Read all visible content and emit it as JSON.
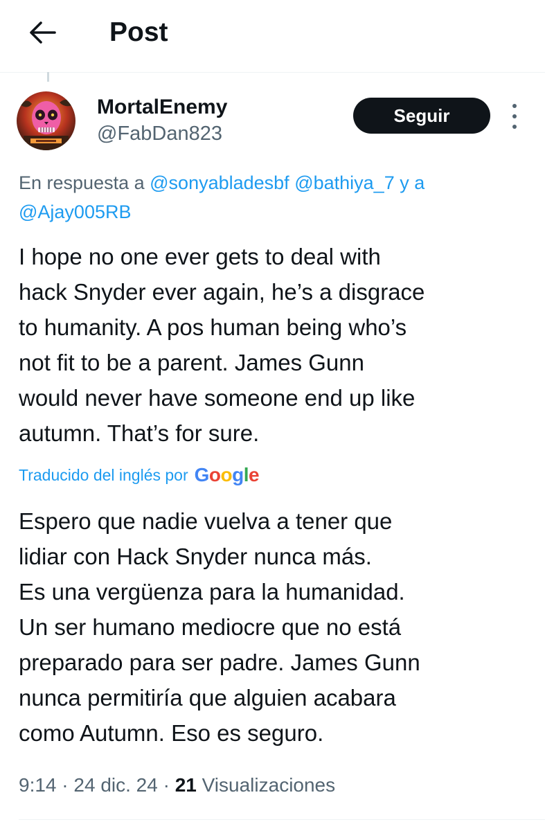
{
  "header": {
    "title": "Post",
    "back_icon": "arrow-left-icon"
  },
  "post": {
    "author": {
      "name": "MortalEnemy",
      "handle": "@FabDan823",
      "avatar": "avatar-image"
    },
    "follow_label": "Seguir",
    "more_icon": "more-vertical-icon",
    "reply_to": {
      "prefix": "En respuesta a",
      "mentions": [
        "@sonyabladesbf",
        "@bathiya_7"
      ],
      "joiner": "y a",
      "last_mention": "@Ajay005RB"
    },
    "text": "I hope no one ever gets to deal with\nhack Snyder ever again, he’s a disgrace\nto humanity. A pos human being who’s\nnot fit to be a parent. James Gunn\nwould never have someone end up like\nautumn. That’s for sure.",
    "translation_label": "Traducido del inglés por",
    "translation_provider": "Google",
    "translated_text": "Espero que nadie vuelva a tener que\nlidiar con Hack Snyder nunca más.\nEs una vergüenza para la humanidad.\nUn ser humano mediocre que no está\npreparado para ser padre. James Gunn\nnunca permitiría que alguien acabara\ncomo Autumn. Eso es seguro.",
    "meta": {
      "time": "9:14",
      "separator": "·",
      "date": "24 dic. 24",
      "views_count": "21",
      "views_label": "Visualizaciones"
    }
  },
  "colors": {
    "link": "#1d9bf0",
    "secondary_text": "#536471",
    "primary_text": "#0f1419",
    "button_bg": "#0f1419"
  }
}
